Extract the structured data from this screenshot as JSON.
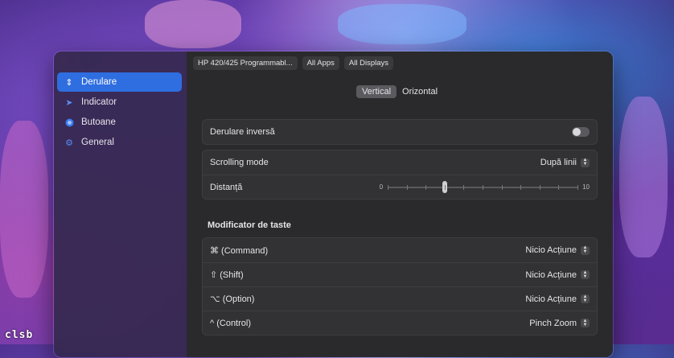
{
  "watermark": "clsb",
  "sidebar": {
    "items": [
      {
        "label": "Derulare",
        "icon": "scroll-arrows-icon",
        "active": true
      },
      {
        "label": "Indicator",
        "icon": "pointer-icon",
        "active": false
      },
      {
        "label": "Butoane",
        "icon": "button-circle-icon",
        "active": false
      },
      {
        "label": "General",
        "icon": "gear-icon",
        "active": false
      }
    ]
  },
  "topbar": {
    "device": "HP 420/425 Programmabl...",
    "apps": "All Apps",
    "displays": "All Displays"
  },
  "segment": {
    "vertical": "Vertical",
    "horizontal": "Orizontal",
    "selected": "Vertical"
  },
  "reverse": {
    "label": "Derulare inversă",
    "enabled": false
  },
  "scrolling": {
    "mode_label": "Scrolling mode",
    "mode_value": "După linii",
    "distance_label": "Distanță",
    "slider_min": "0",
    "slider_max": "10",
    "slider_value": 3
  },
  "modifiers": {
    "title": "Modificator de taste",
    "rows": [
      {
        "key": "⌘ (Command)",
        "value": "Nicio Acțiune"
      },
      {
        "key": "⇧ (Shift)",
        "value": "Nicio Acțiune"
      },
      {
        "key": "⌥ (Option)",
        "value": "Nicio Acțiune"
      },
      {
        "key": "^ (Control)",
        "value": "Pinch Zoom"
      }
    ]
  },
  "colors": {
    "accent": "#2f6ee0",
    "close": "#ff5f57"
  }
}
